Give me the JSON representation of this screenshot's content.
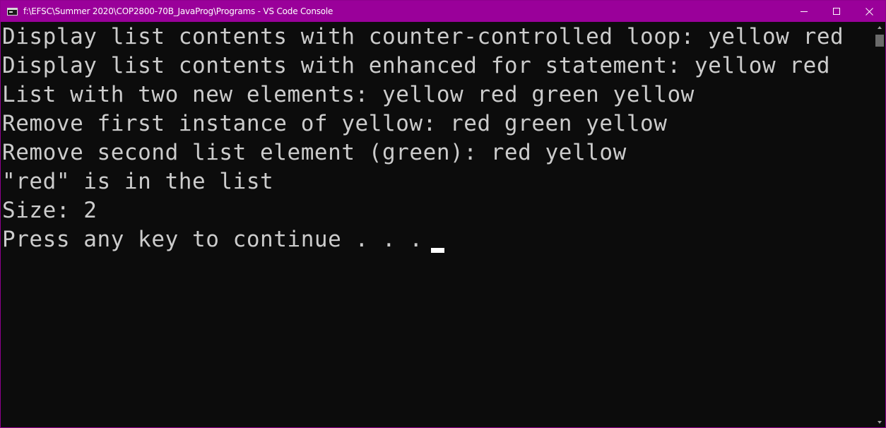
{
  "window": {
    "title": "f:\\EFSC\\Summer 2020\\COP2800-70B_JavaProg\\Programs - VS Code Console",
    "title_bar_color": "#9a009a",
    "controls": {
      "minimize": "minimize-icon",
      "maximize": "maximize-icon",
      "close": "close-icon"
    }
  },
  "console": {
    "background": "#0c0c0c",
    "foreground": "#cccccc",
    "lines": [
      "Display list contents with counter-controlled loop: yellow red",
      "Display list contents with enhanced for statement: yellow red",
      "List with two new elements: yellow red green yellow",
      "Remove first instance of yellow: red green yellow",
      "Remove second list element (green): red yellow",
      "\"red\" is in the list",
      "Size: 2",
      "Press any key to continue . . . "
    ]
  }
}
